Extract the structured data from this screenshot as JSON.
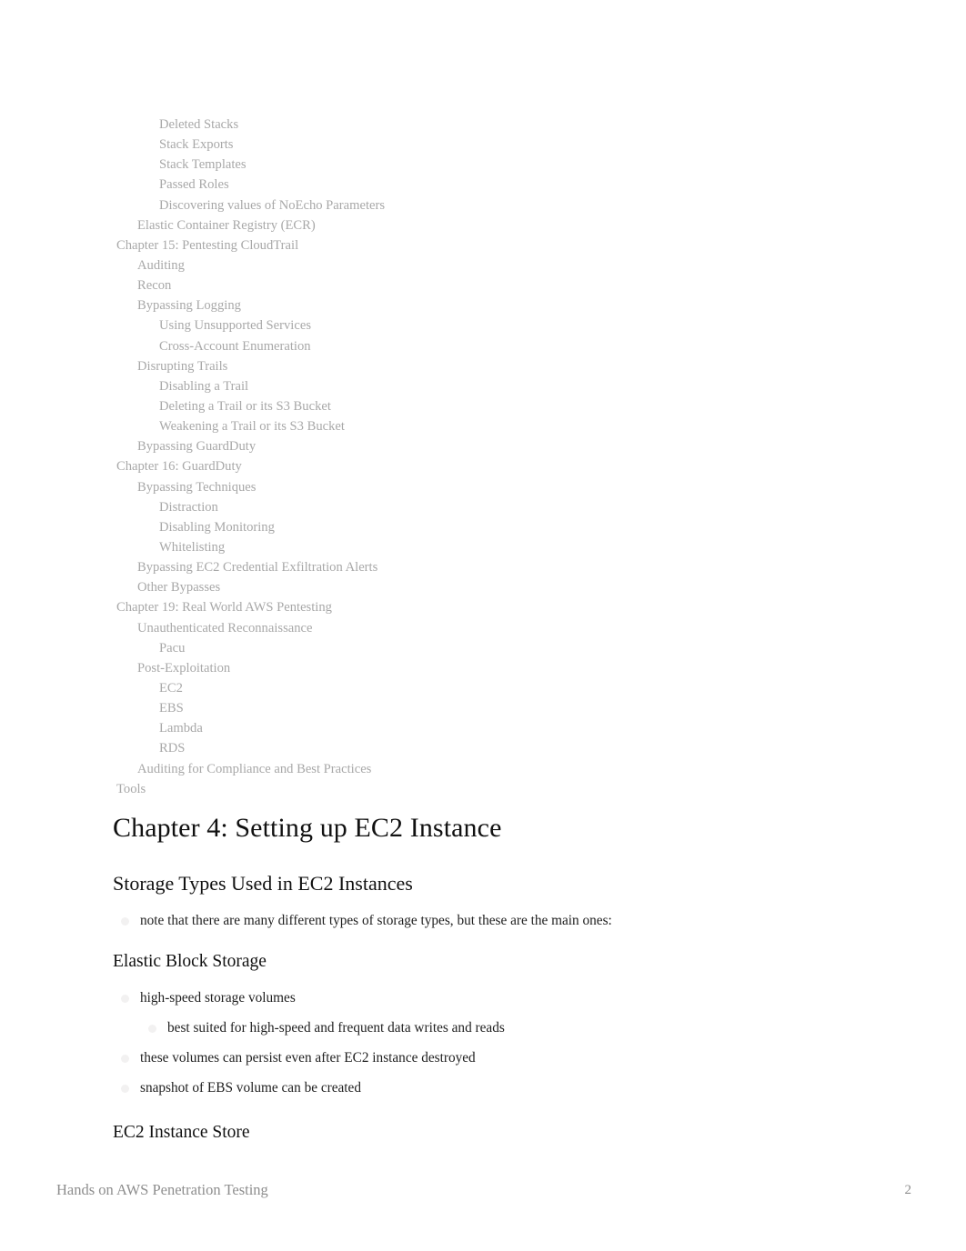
{
  "document": {
    "footer_title": "Hands on AWS Penetration Testing",
    "page_number": "2",
    "background_color": "#ffffff",
    "toc_text_color": "#a8a8a8",
    "body_text_color": "#1f1f1f",
    "footer_text_color": "#8e8e8e",
    "bullet_color": "#f2f1f1"
  },
  "toc": {
    "entries": [
      {
        "label": "Deleted Stacks",
        "level": 3
      },
      {
        "label": "Stack Exports",
        "level": 3
      },
      {
        "label": "Stack Templates",
        "level": 3
      },
      {
        "label": "Passed Roles",
        "level": 3
      },
      {
        "label": "Discovering values of NoEcho Parameters",
        "level": 3
      },
      {
        "label": "Elastic Container Registry (ECR)",
        "level": 2
      },
      {
        "label": "Chapter 15: Pentesting CloudTrail",
        "level": 1
      },
      {
        "label": "Auditing",
        "level": 2
      },
      {
        "label": "Recon",
        "level": 2
      },
      {
        "label": "Bypassing Logging",
        "level": 2
      },
      {
        "label": "Using Unsupported Services",
        "level": 3
      },
      {
        "label": "Cross-Account Enumeration",
        "level": 3
      },
      {
        "label": "Disrupting Trails",
        "level": 2
      },
      {
        "label": "Disabling a Trail",
        "level": 3
      },
      {
        "label": "Deleting a Trail or its S3 Bucket",
        "level": 3
      },
      {
        "label": "Weakening a Trail or its S3 Bucket",
        "level": 3
      },
      {
        "label": "Bypassing GuardDuty",
        "level": 2
      },
      {
        "label": "Chapter 16: GuardDuty",
        "level": 1
      },
      {
        "label": "Bypassing Techniques",
        "level": 2
      },
      {
        "label": "Distraction",
        "level": 3
      },
      {
        "label": "Disabling Monitoring",
        "level": 3
      },
      {
        "label": "Whitelisting",
        "level": 3
      },
      {
        "label": "Bypassing EC2 Credential Exfiltration Alerts",
        "level": 2
      },
      {
        "label": "Other Bypasses",
        "level": 2
      },
      {
        "label": "Chapter 19: Real World AWS Pentesting",
        "level": 1
      },
      {
        "label": "Unauthenticated Reconnaissance",
        "level": 2
      },
      {
        "label": "Pacu",
        "level": 3
      },
      {
        "label": "Post-Exploitation",
        "level": 2
      },
      {
        "label": "EC2",
        "level": 3
      },
      {
        "label": "EBS",
        "level": 3
      },
      {
        "label": "Lambda",
        "level": 3
      },
      {
        "label": "RDS",
        "level": 3
      },
      {
        "label": "Auditing for Compliance and Best Practices",
        "level": 2
      },
      {
        "label": "Tools",
        "level": 1
      }
    ]
  },
  "content": {
    "chapter_heading": "Chapter 4: Setting up EC2 Instance",
    "section_heading": "Storage Types Used in EC2 Instances",
    "section_note": "note that there are many different types of storage types, but these are the main ones:",
    "subsection_heading": "Elastic Block Storage",
    "ebs_bullets": [
      {
        "text": "high-speed storage volumes",
        "level": 1
      },
      {
        "text": "best suited for high-speed and frequent data writes and reads",
        "level": 2
      },
      {
        "text": "these volumes can persist even after EC2 instance destroyed",
        "level": 1
      },
      {
        "text": "snapshot of EBS volume can be created",
        "level": 1
      }
    ],
    "subsection_heading_2": "EC2 Instance Store"
  }
}
